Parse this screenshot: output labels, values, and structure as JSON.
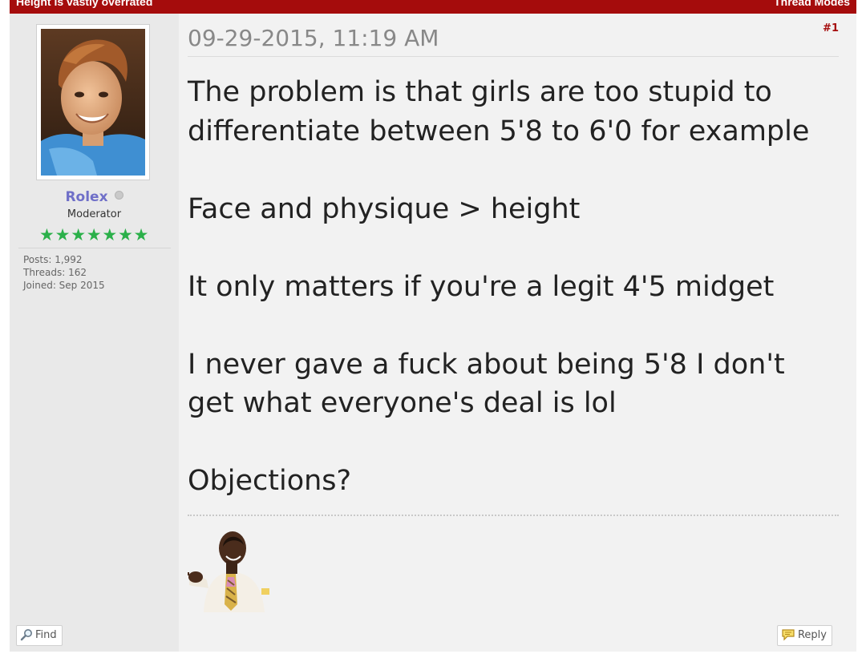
{
  "thread": {
    "title": "Height is vastly overrated",
    "modes_label": "Thread Modes"
  },
  "author": {
    "username": "Rolex",
    "status": "offline",
    "user_title": "Moderator",
    "stars": 7,
    "star_glyph": "★",
    "stats": {
      "posts": "Posts: 1,992",
      "threads": "Threads: 162",
      "joined": "Joined: Sep 2015"
    }
  },
  "post": {
    "date": "09-29-2015, 11:19 AM",
    "number": "#1",
    "paragraphs": [
      "The problem is that girls are too stupid to differentiate between 5'8 to 6'0 for example",
      "Face and physique > height",
      "It only matters if you're a legit 4'5 midget",
      "I never gave a fuck about being 5'8 I don't get what everyone's deal is lol",
      "Objections?"
    ]
  },
  "buttons": {
    "find_label": "Find",
    "reply_label": "Reply"
  },
  "icons": {
    "find": "magnifier-icon",
    "reply": "speech-bubble-icon"
  },
  "colors": {
    "header_bg": "#a50c0c",
    "username": "#6f6fc8",
    "stars": "#2bb04a",
    "post_bg": "#f2f2f2",
    "author_bg": "#e9e9e9"
  }
}
